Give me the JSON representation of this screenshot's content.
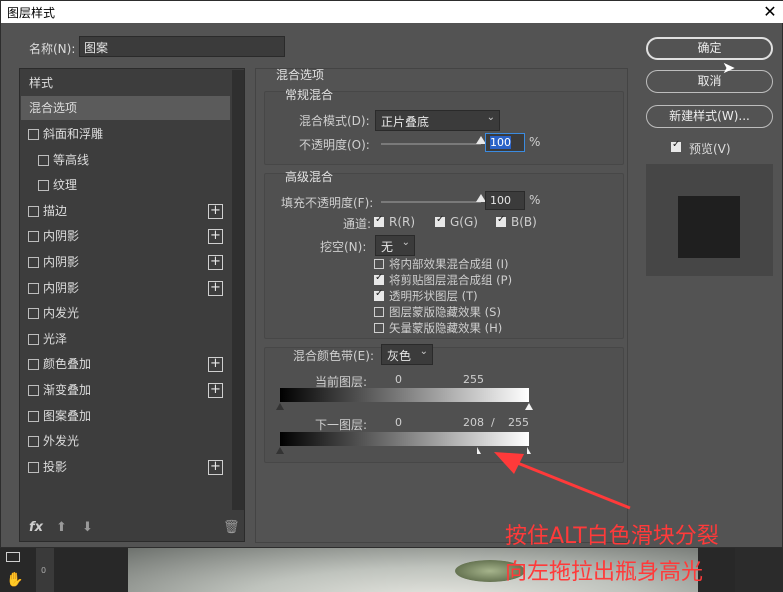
{
  "window": {
    "title": "图层样式",
    "close_glyph": "✕"
  },
  "name_field": {
    "label": "名称(N):",
    "value": "图案"
  },
  "style_list": {
    "header": "样式",
    "selected": "混合选项",
    "items": [
      {
        "label": "斜面和浮雕",
        "has_plus": false,
        "checked": false,
        "indent": false
      },
      {
        "label": "等高线",
        "has_plus": false,
        "checked": false,
        "indent": true
      },
      {
        "label": "纹理",
        "has_plus": false,
        "checked": false,
        "indent": true
      },
      {
        "label": "描边",
        "has_plus": true,
        "checked": false,
        "indent": false
      },
      {
        "label": "内阴影",
        "has_plus": true,
        "checked": false,
        "indent": false
      },
      {
        "label": "内阴影",
        "has_plus": true,
        "checked": false,
        "indent": false
      },
      {
        "label": "内阴影",
        "has_plus": true,
        "checked": false,
        "indent": false
      },
      {
        "label": "内发光",
        "has_plus": false,
        "checked": false,
        "indent": false
      },
      {
        "label": "光泽",
        "has_plus": false,
        "checked": false,
        "indent": false
      },
      {
        "label": "颜色叠加",
        "has_plus": true,
        "checked": false,
        "indent": false
      },
      {
        "label": "渐变叠加",
        "has_plus": true,
        "checked": false,
        "indent": false
      },
      {
        "label": "图案叠加",
        "has_plus": false,
        "checked": false,
        "indent": false
      },
      {
        "label": "外发光",
        "has_plus": false,
        "checked": false,
        "indent": false
      },
      {
        "label": "投影",
        "has_plus": true,
        "checked": false,
        "indent": false
      }
    ],
    "plus_glyph": "+",
    "footer_icons": [
      "fx-icon",
      "move-up-icon",
      "move-down-icon",
      "trash-icon"
    ],
    "fx_label": "fx"
  },
  "blend_options": {
    "title": "混合选项",
    "general": {
      "title": "常规混合",
      "mode_label": "混合模式(D):",
      "mode_value": "正片叠底",
      "opacity_label": "不透明度(O):",
      "opacity_value": "100",
      "opacity_fraction": 1.0,
      "unit": "%"
    },
    "advanced": {
      "title": "高级混合",
      "fill_label": "填充不透明度(F):",
      "fill_value": "100",
      "fill_fraction": 1.0,
      "unit": "%",
      "channels_label": "通道:",
      "channels": [
        {
          "label": "R(R)",
          "checked": true
        },
        {
          "label": "G(G)",
          "checked": true
        },
        {
          "label": "B(B)",
          "checked": true
        }
      ],
      "knockout_label": "挖空(N):",
      "knockout_value": "无",
      "options": [
        {
          "label": "将内部效果混合成组 (I)",
          "checked": false
        },
        {
          "label": "将剪贴图层混合成组 (P)",
          "checked": true
        },
        {
          "label": "透明形状图层 (T)",
          "checked": true
        },
        {
          "label": "图层蒙版隐藏效果 (S)",
          "checked": false
        },
        {
          "label": "矢量蒙版隐藏效果 (H)",
          "checked": false
        }
      ]
    },
    "blend_if": {
      "label": "混合颜色带(E):",
      "value": "灰色",
      "this_layer": {
        "label": "当前图层:",
        "low": "0",
        "high": "255"
      },
      "underlying": {
        "label": "下一图层:",
        "low": "0",
        "high_split": "208",
        "separator": "/",
        "high": "255"
      }
    }
  },
  "buttons": {
    "ok": "确定",
    "cancel": "取消",
    "new_style": "新建样式(W)...",
    "preview_label": "预览(V)",
    "preview_checked": true
  },
  "annotation": {
    "line1": "按住ALT白色滑块分裂",
    "line2": "向左拖拉出瓶身高光",
    "color": "#ff3a3a"
  },
  "background": {
    "ruler_text": "0"
  }
}
